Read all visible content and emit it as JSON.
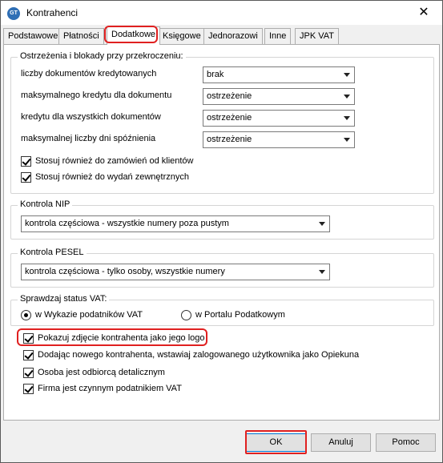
{
  "window": {
    "title": "Kontrahenci",
    "close_symbol": "✕",
    "app_icon_text": "GT"
  },
  "tabs": [
    {
      "label": "Podstawowe"
    },
    {
      "label": "Płatności"
    },
    {
      "label": "Dodatkowe"
    },
    {
      "label": "Księgowe"
    },
    {
      "label": "Jednorazowi"
    },
    {
      "label": "Inne"
    },
    {
      "label": "JPK VAT"
    }
  ],
  "warnings_group": {
    "title": "Ostrzeżenia i blokady przy przekroczeniu:",
    "rows": [
      {
        "label": "liczby dokumentów kredytowanych",
        "value": "brak"
      },
      {
        "label": "maksymalnego kredytu dla  dokumentu",
        "value": "ostrzeżenie"
      },
      {
        "label": "kredytu dla wszystkich dokumentów",
        "value": "ostrzeżenie"
      },
      {
        "label": "maksymalnej liczby dni spóźnienia",
        "value": "ostrzeżenie"
      }
    ],
    "checks": [
      {
        "label": "Stosuj również do zamówień od klientów",
        "checked": true
      },
      {
        "label": "Stosuj również do wydań zewnętrznych",
        "checked": true
      }
    ]
  },
  "nip_group": {
    "title": "Kontrola NIP",
    "value": "kontrola częściowa - wszystkie numery poza pustym"
  },
  "pesel_group": {
    "title": "Kontrola PESEL",
    "value": "kontrola częściowa - tylko osoby, wszystkie numery"
  },
  "vat_group": {
    "title": "Sprawdzaj status VAT:",
    "options": [
      {
        "label": "w Wykazie podatników VAT",
        "selected": true
      },
      {
        "label": "w Portalu Podatkowym",
        "selected": false
      }
    ]
  },
  "bottom_checks": [
    {
      "label": "Pokazuj zdjęcie kontrahenta jako jego logo",
      "checked": true
    },
    {
      "label": "Dodając nowego kontrahenta, wstawiaj zalogowanego użytkownika jako Opiekuna",
      "checked": true
    },
    {
      "label": "Osoba jest odbiorcą detalicznym",
      "checked": true
    },
    {
      "label": "Firma jest czynnym podatnikiem VAT",
      "checked": true
    }
  ],
  "buttons": {
    "ok": "OK",
    "cancel": "Anuluj",
    "help": "Pomoc"
  },
  "colors": {
    "highlight": "#e02020",
    "accent": "#0078d7"
  }
}
